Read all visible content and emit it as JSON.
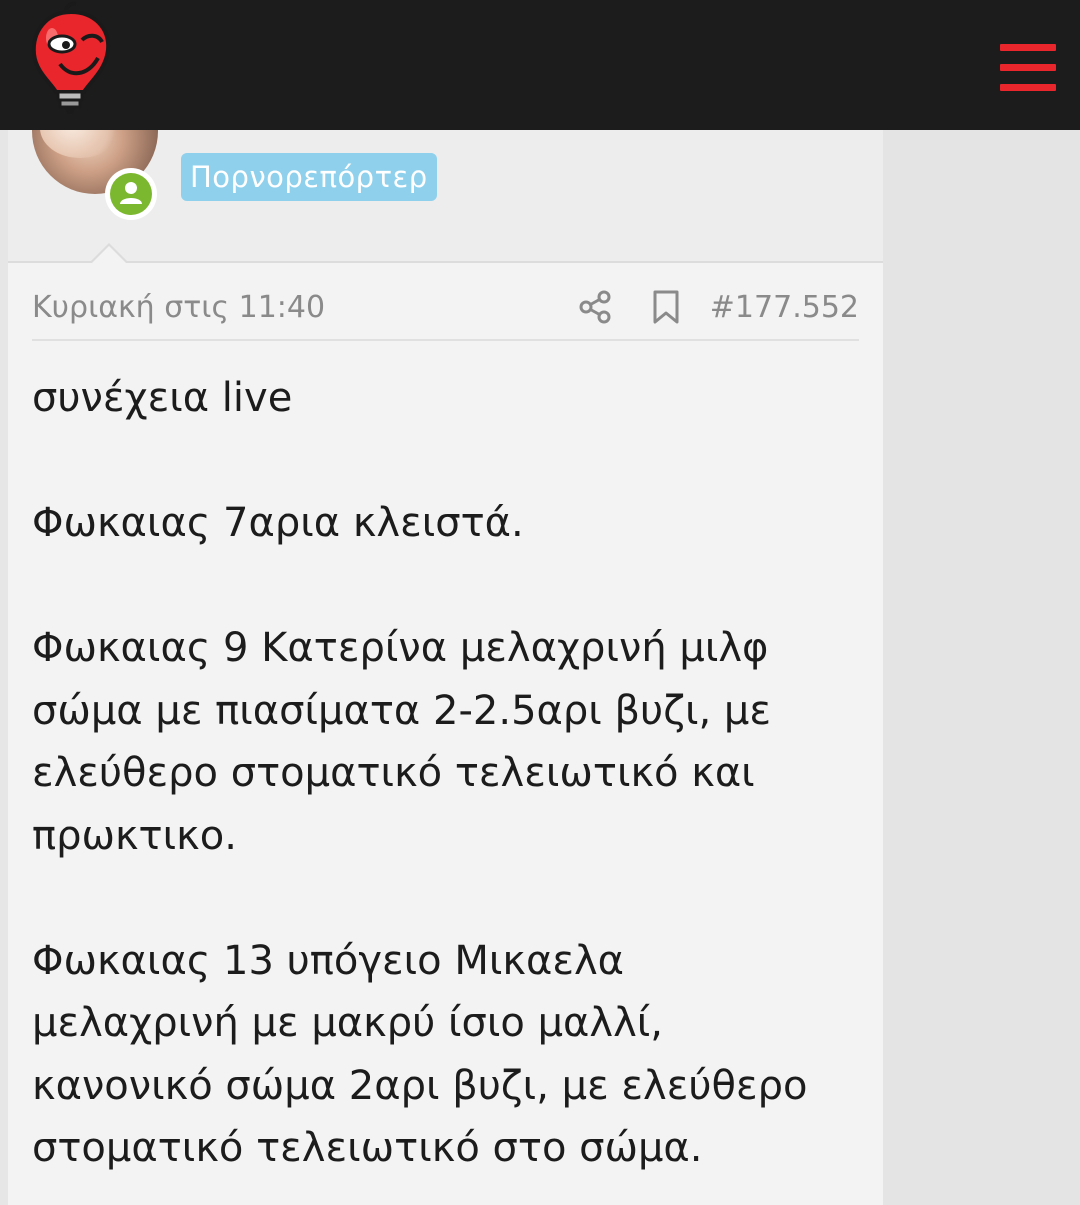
{
  "header": {
    "logo_icon": "lightbulb-mascot-icon",
    "menu_icon": "hamburger-menu-icon",
    "accent_color": "#e8262b",
    "bar_color": "#1c1c1c"
  },
  "post": {
    "user": {
      "title_badge": "Πορνορεπόρτερ",
      "badge_color": "#8fd1ec",
      "status_icon": "user-online-icon",
      "status_color": "#7cb82f"
    },
    "meta": {
      "date": "Κυριακή στις 11:40",
      "share_icon": "share-icon",
      "bookmark_icon": "bookmark-icon",
      "post_number": "#177.552"
    },
    "body": {
      "lines": [
        "συνέχεια live",
        "",
        "Φωκαιας 7αρια κλειστά.",
        "",
        "Φωκαιας 9 Κατερίνα μελαχρινή μιλφ",
        "σώμα με πιασίματα 2-2.5αρι βυζι, με",
        "ελεύθερο στοματικό τελειωτικό και",
        "πρωκτικο.",
        "",
        "Φωκαιας 13 υπόγειο Μικαελα",
        "μελαχρινή με μακρύ ίσιο μαλλί,",
        "κανονικό σώμα 2αρι βυζι, με ελεύθερο",
        "στοματικό τελειωτικό στο σώμα."
      ]
    }
  }
}
